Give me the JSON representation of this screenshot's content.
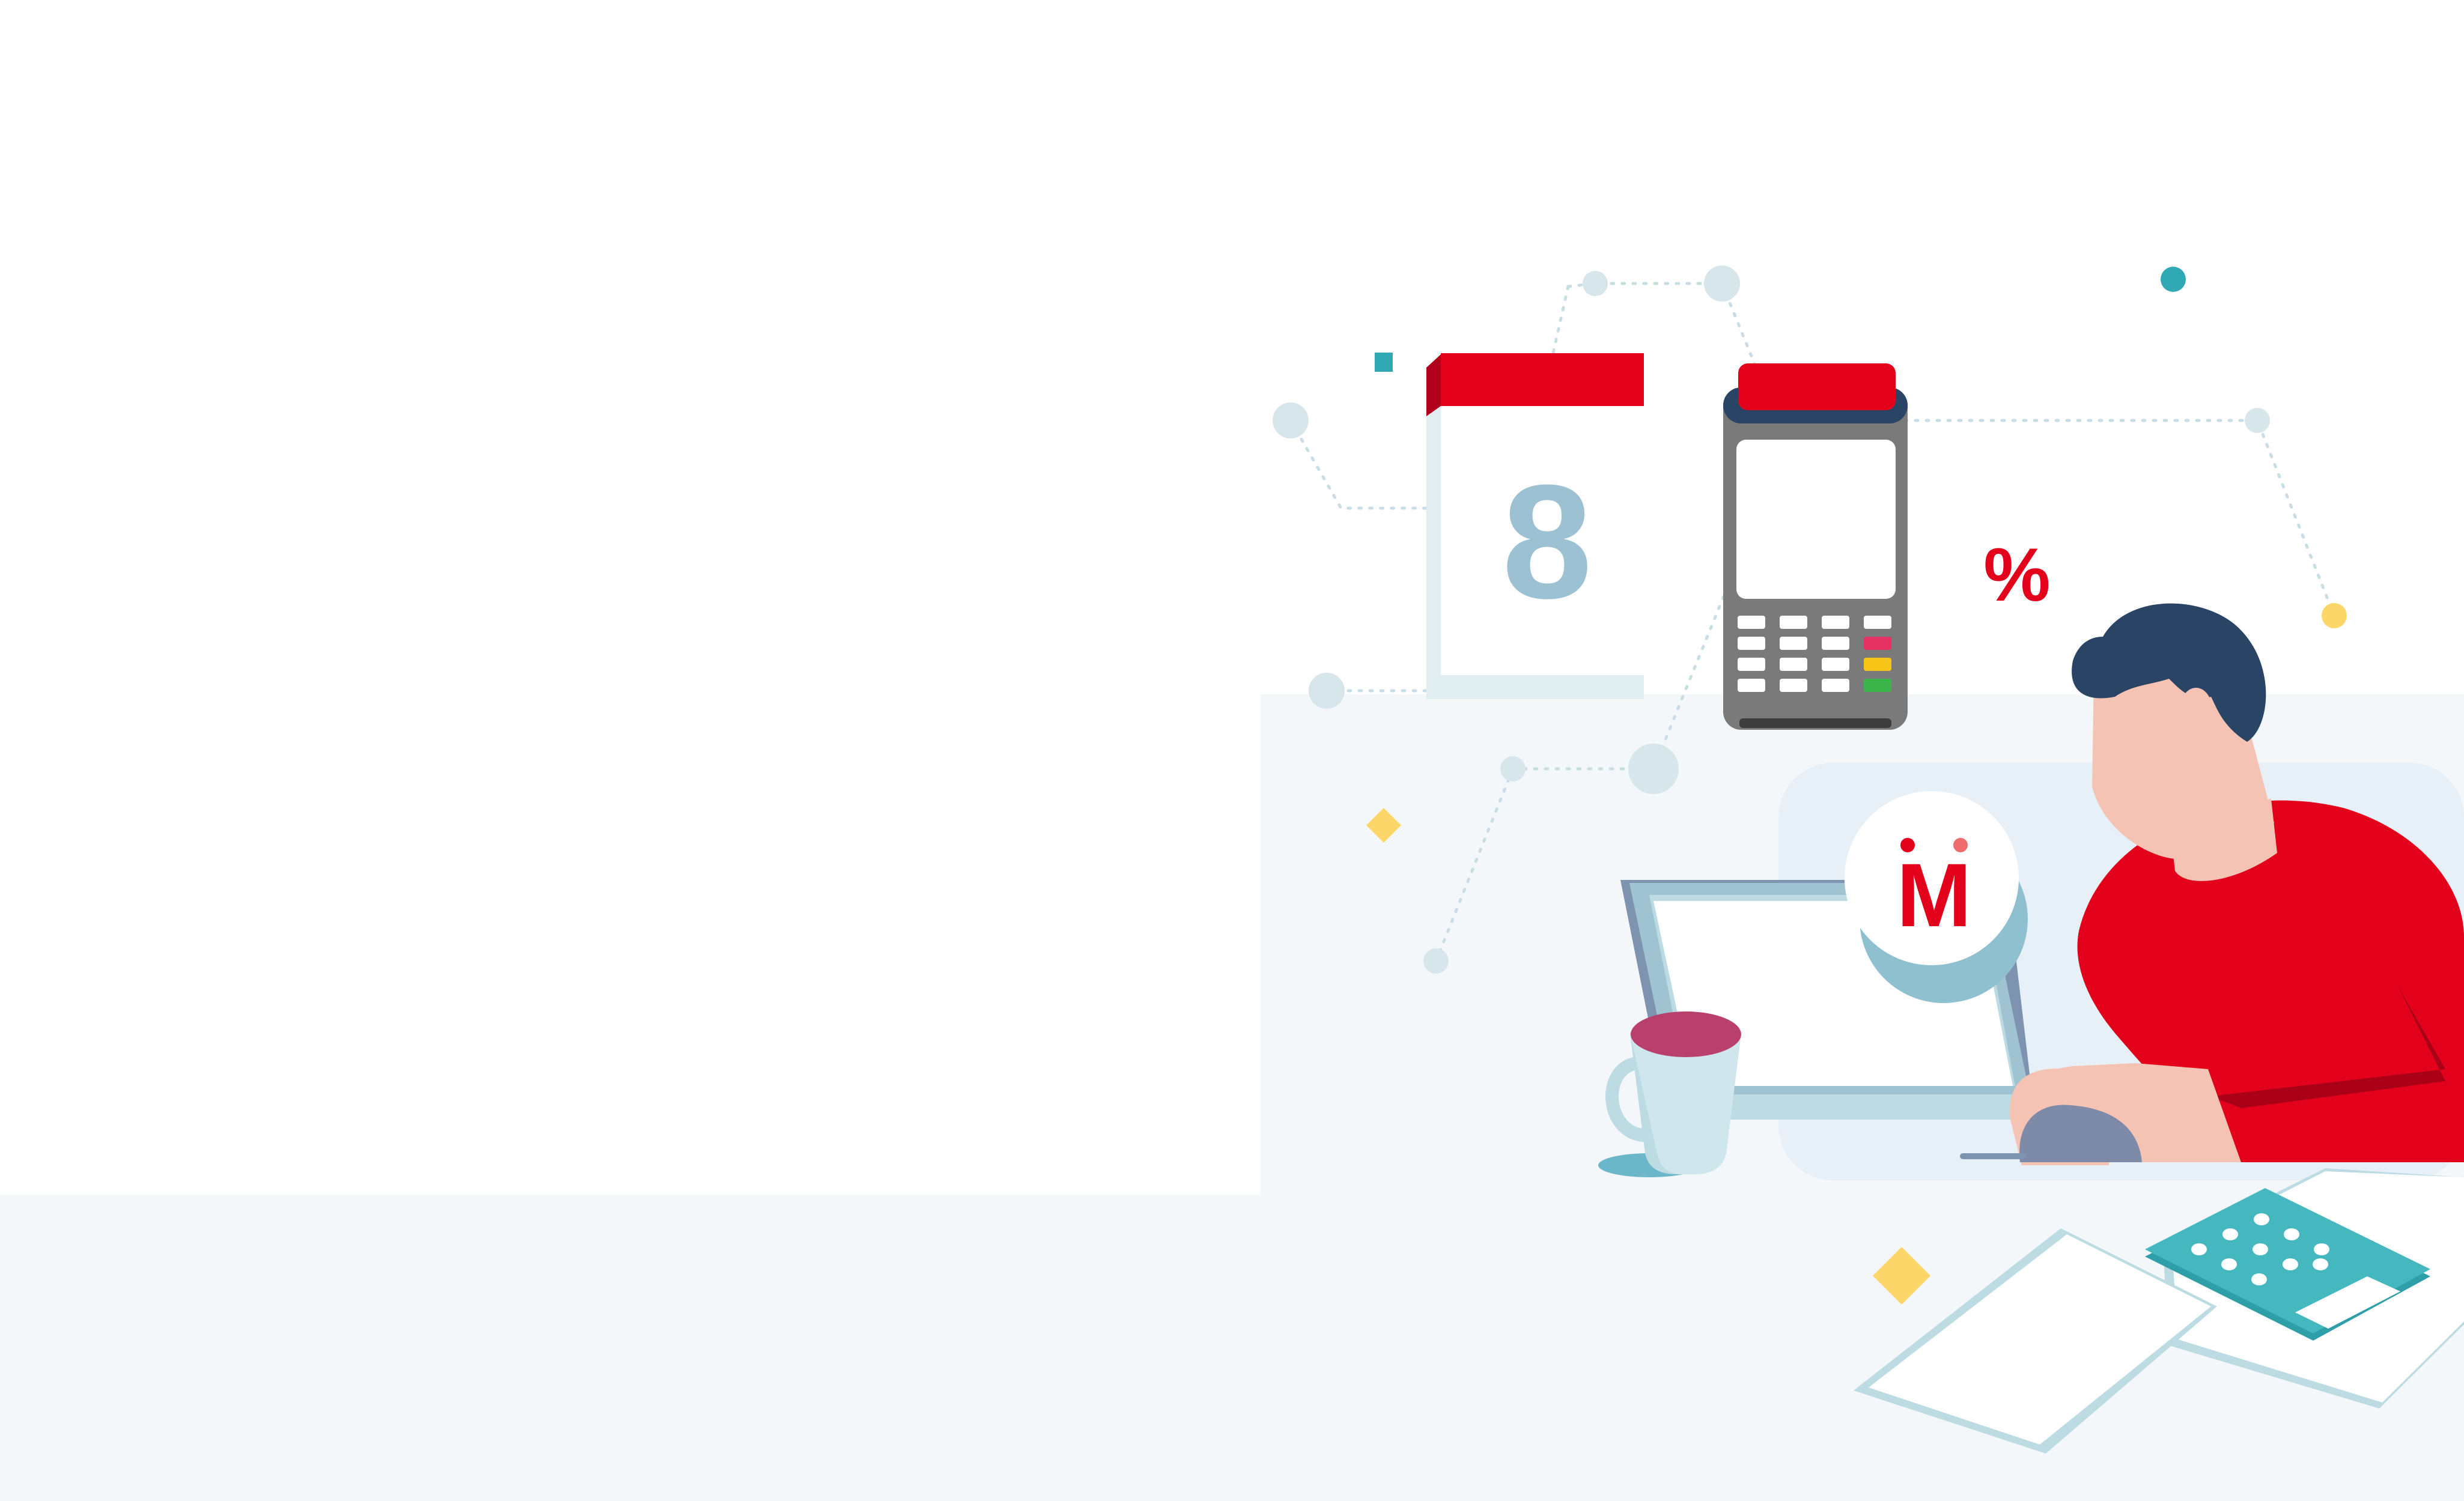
{
  "illustration": {
    "calendar": {
      "day": "8"
    },
    "percent_symbol": "%",
    "logo_letter": "M",
    "colors": {
      "brand_red": "#e3001b",
      "navy": "#2a4466",
      "teal": "#45b8bf",
      "light_blue": "#bcdbe3",
      "yellow": "#fcd669",
      "skin": "#f4c3b4",
      "terminal_gray": "#7a7a7a",
      "mug_top": "#b9406d",
      "background": "#f4f7fa"
    }
  }
}
